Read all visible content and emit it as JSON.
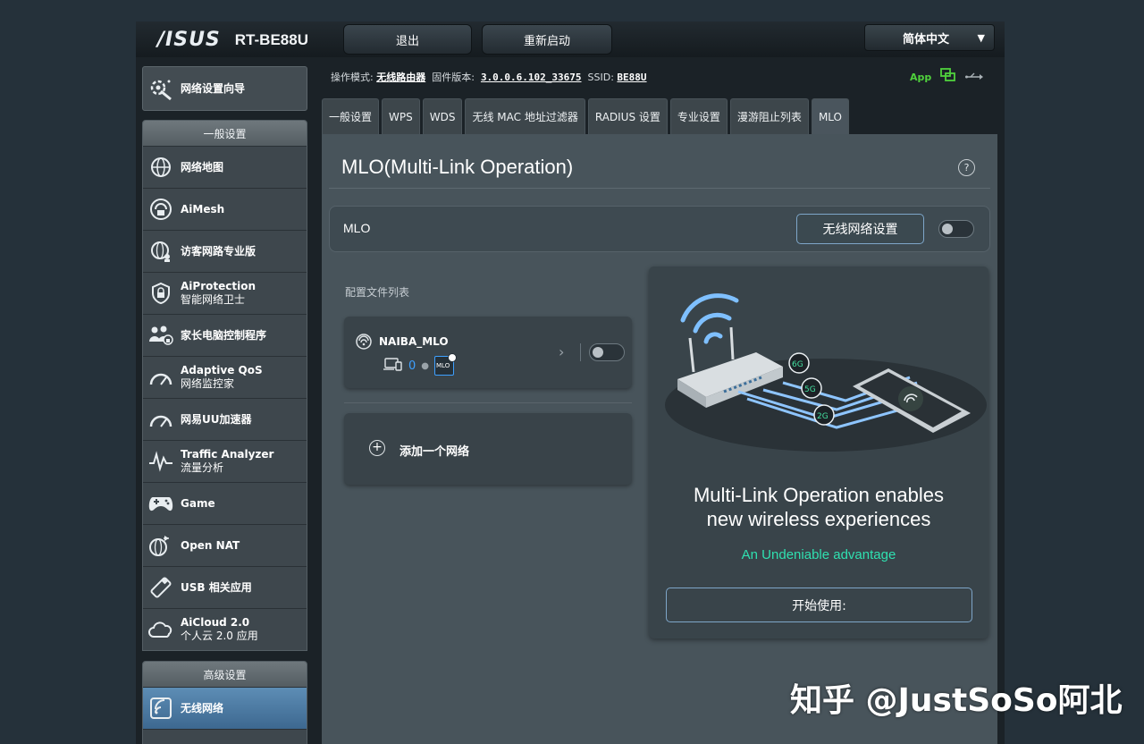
{
  "header": {
    "logo": "/ISUS",
    "model": "RT-BE88U",
    "logout_label": "退出",
    "reboot_label": "重新启动",
    "language": "简体中文"
  },
  "status": {
    "mode_label": "操作模式:",
    "mode_value": "无线路由器",
    "fw_label": "固件版本:",
    "fw_value": "3.0.0.6.102_33675",
    "ssid_label": "SSID:",
    "ssid_value": "BE88U",
    "app_label": "App"
  },
  "sidebar": {
    "wizard": "网络设置向导",
    "general_title": "一般设置",
    "general_items": [
      {
        "label": "网络地图",
        "sub": ""
      },
      {
        "label": "AiMesh",
        "sub": ""
      },
      {
        "label": "访客网路专业版",
        "sub": ""
      },
      {
        "label": "AiProtection",
        "sub": "智能网络卫士"
      },
      {
        "label": "家长电脑控制程序",
        "sub": ""
      },
      {
        "label": "Adaptive QoS",
        "sub": "网络监控家"
      },
      {
        "label": "网易UU加速器",
        "sub": ""
      },
      {
        "label": "Traffic Analyzer",
        "sub": "流量分析"
      },
      {
        "label": "Game",
        "sub": ""
      },
      {
        "label": "Open NAT",
        "sub": ""
      },
      {
        "label": "USB 相关应用",
        "sub": ""
      },
      {
        "label": "AiCloud 2.0",
        "sub": "个人云 2.0 应用"
      }
    ],
    "advanced_title": "高级设置",
    "advanced_items": [
      {
        "label": "无线网络"
      }
    ]
  },
  "tabs": [
    "一般设置",
    "WPS",
    "WDS",
    "无线 MAC 地址过滤器",
    "RADIUS 设置",
    "专业设置",
    "漫游阻止列表",
    "MLO"
  ],
  "page": {
    "title": "MLO(Multi-Link Operation)",
    "help": "?",
    "mlo_label": "MLO",
    "wifi_settings_button": "无线网络设置",
    "profiles_label": "配置文件列表",
    "profile": {
      "name": "NAIBA_MLO",
      "device_count": "0",
      "badge": "MLO"
    },
    "add_network": "添加一个网络",
    "promo_title_line1": "Multi-Link Operation enables",
    "promo_title_line2": "new wireless experiences",
    "promo_subtitle": "An Undeniable advantage",
    "start_button": "开始使用:",
    "band_labels": [
      "6G",
      "5G",
      "2G"
    ]
  },
  "watermark": "知乎 @JustSoSo阿北",
  "colors": {
    "accent": "#3ea0ff",
    "promo_green": "#2fe0b0",
    "active_menu": "#4f7fa8"
  }
}
